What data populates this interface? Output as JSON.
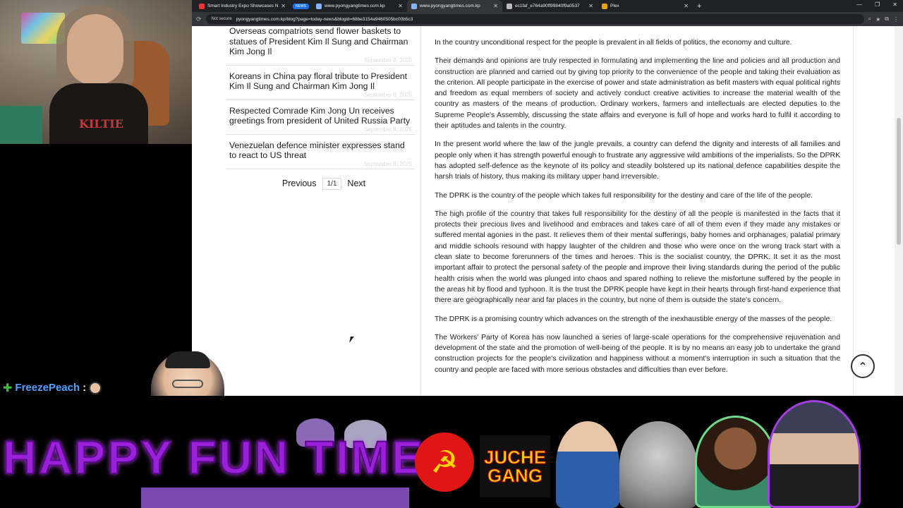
{
  "browser": {
    "tabs": [
      {
        "label": "Smart Industry Expo Showcases N",
        "favicon": "youtube-icon"
      },
      {
        "label": "www.pyongyangtimes.com.kp",
        "favicon": "globe-icon",
        "group": "NEWS"
      },
      {
        "label": "www.pyongyangtimes.com.kp",
        "favicon": "globe-icon"
      },
      {
        "label": "ec1faf_e764a90ff99840f9a0537",
        "favicon": "doc-icon"
      },
      {
        "label": "Plex",
        "favicon": "plex-icon"
      }
    ],
    "address": {
      "security": "Not secure",
      "url": "pyongyangtimes.com.kp/blog?page=today-news&blogid=68be3154a9460505bc00b5c3"
    }
  },
  "sidebar": {
    "items": [
      {
        "title": "Overseas compatriots send flower baskets to statues of President Kim Il Sung and Chairman Kim Jong Il",
        "date": "September 8, 2025"
      },
      {
        "title": "Koreans in China pay floral tribute to President Kim Il Sung and Chairman Kim Jong Il",
        "date": "September 8, 2025"
      },
      {
        "title": "Respected Comrade Kim Jong Un receives greetings from president of United Russia Party",
        "date": "September 8, 2025"
      },
      {
        "title": "Venezuelan defence minister expresses stand to react to US threat",
        "date": "September 8, 2025"
      }
    ],
    "pager": {
      "previous": "Previous",
      "page": "1/1",
      "next": "Next"
    }
  },
  "article": {
    "paragraphs": [
      "In the country unconditional respect for the people is prevalent in all fields of politics, the economy and culture.",
      "Their demands and opinions are truly respected in formulating and implementing the line and policies and all production and construction are planned and carried out by giving top priority to the convenience of the people and taking their evaluation as the criterion. All people participate in the exercise of power and state administration as befit masters with equal political rights and freedom as equal members of society and actively conduct creative activities to increase the material wealth of the country as masters of the means of production. Ordinary workers, farmers and intellectuals are elected deputies to the Supreme People's Assembly, discussing the state affairs and everyone is full of hope and works hard to fulfil it according to their aptitudes and talents in the country.",
      "In the present world where the law of the jungle prevails, a country can defend the dignity and interests of all families and people only when it has strength powerful enough to frustrate any aggressive wild ambitions of the imperialists. So the DPRK has adopted self-defence as the keynote of its policy and steadily bolstered up its national defence capabilities despite the harsh trials of history, thus making its military upper hand irreversible.",
      "The DPRK is the country of the people which takes full responsibility for the destiny and care of the life of the people.",
      "The high profile of the country that takes full responsibility for the destiny of all the people is manifested in the facts that it protects their precious lives and livelihood and embraces and takes care of all of them even if they made any mistakes or suffered mental agonies in the past. It relieves them of their mental sufferings, baby homes and orphanages, palatial primary and middle schools resound with happy laughter of the children and those who were once on the wrong track start with a clean slate to become forerunners of the times and heroes. This is the socialist country, the DPRK. It set it as the most important affair to protect the personal safety of the people and improve their living standards during the period of the public health crisis when the world was plunged into chaos and spared nothing to relieve the misfortune suffered by the people in the areas hit by flood and typhoon. It is the trust the DPRK people have kept in their hearts through first-hand experience that there are geographically near and far places in the country, but none of them is outside the state's concern.",
      "The DPRK is a promising country which advances on the strength of the inexhaustible energy of the masses of the people.",
      "The Workers' Party of Korea has now launched a series of large-scale operations for the comprehensive rejuvenation and development of the state and the promotion of well-being of the people. It is by no means an easy job to undertake the grand construction projects for the people's civilization and happiness without a moment's interruption in such a situation that the country and people are faced with more serious obstacles and difficulties than ever before."
    ]
  },
  "stream": {
    "chat_user": "FreezePeach",
    "chat_sep": ":",
    "shirt_text": "KILTIE",
    "banner_text": "HAPPY FUN TIME?",
    "juche_line1": "JUCHE",
    "juche_line2": "GANG"
  },
  "colors": {
    "banner": "#9b20d9",
    "chat_name": "#4fa3ff",
    "party_red": "#e01515"
  }
}
